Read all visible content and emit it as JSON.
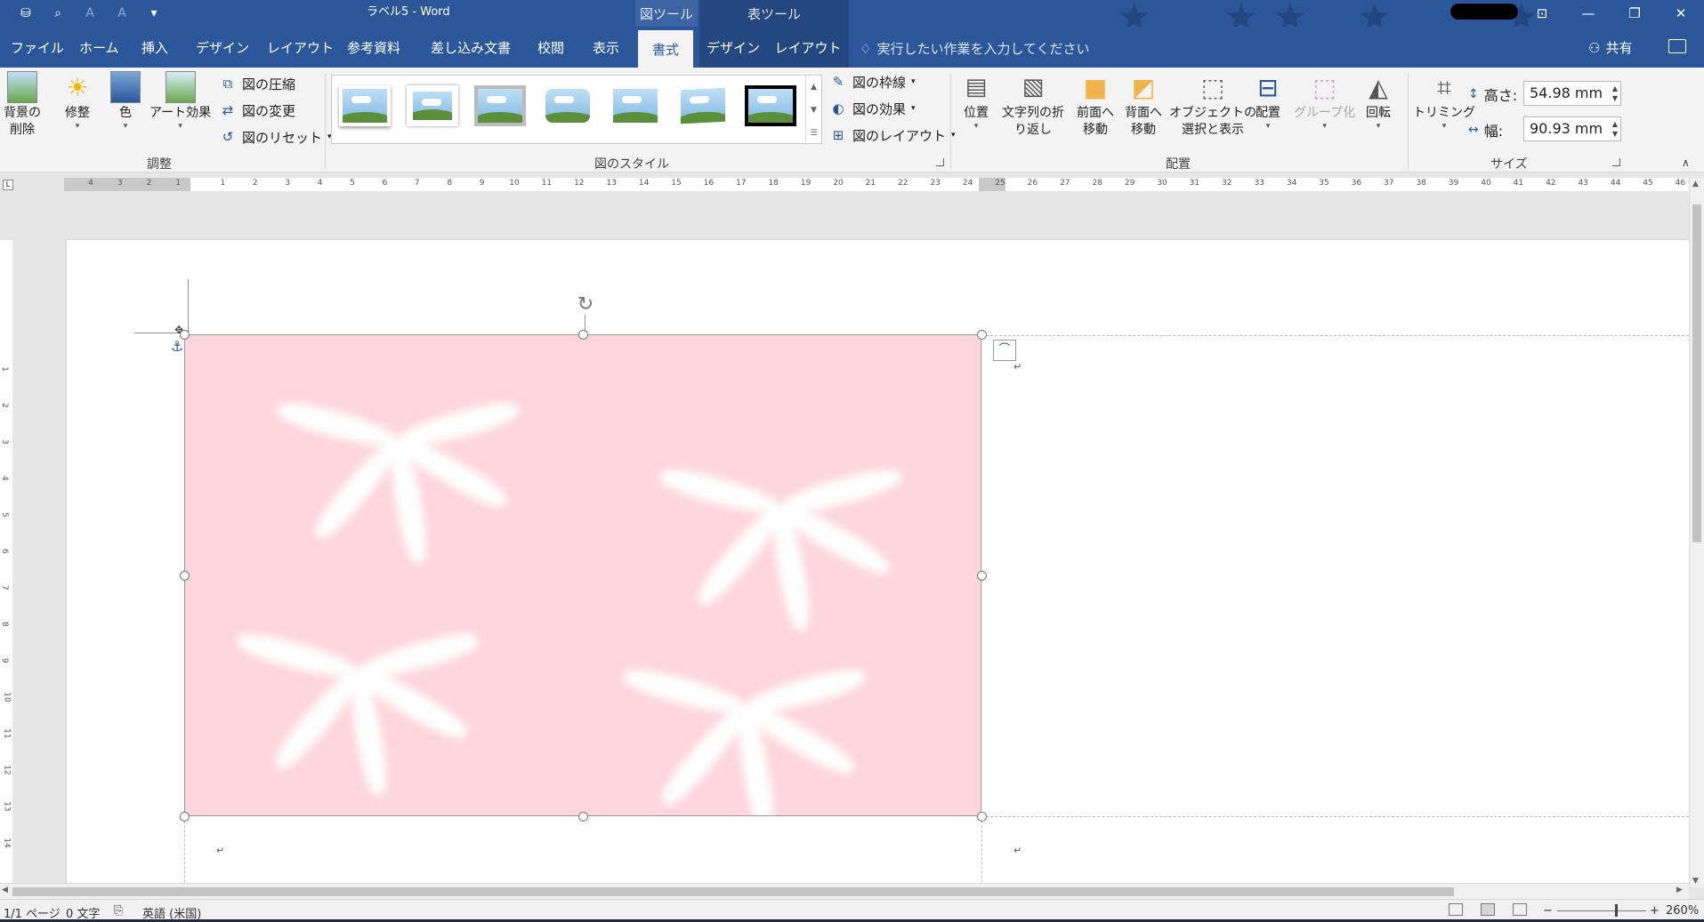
{
  "titlebar": {
    "doc_title": "ラベル5 - Word",
    "context_tab_picture_tools": "図ツール",
    "context_tab_table_tools": "表ツール",
    "window_buttons": [
      "ribbon-display",
      "minimize",
      "restore",
      "close"
    ]
  },
  "tabs": [
    {
      "label": "ファイル"
    },
    {
      "label": "ホーム"
    },
    {
      "label": "挿入"
    },
    {
      "label": "デザイン"
    },
    {
      "label": "レイアウト"
    },
    {
      "label": "参考資料"
    },
    {
      "label": "差し込み文書"
    },
    {
      "label": "校閲"
    },
    {
      "label": "表示"
    },
    {
      "label": "書式"
    },
    {
      "label": "デザイン"
    },
    {
      "label": "レイアウト"
    }
  ],
  "tell_me": "実行したい作業を入力してください",
  "share": "共有",
  "ribbon": {
    "adjust": {
      "remove_bg_1": "背景の",
      "remove_bg_2": "削除",
      "corrections": "修整",
      "color": "色",
      "artistic": "アート効果",
      "compress": "図の圧縮",
      "change": "図の変更",
      "reset": "図のリセット",
      "group_label": "調整"
    },
    "styles": {
      "border": "図の枠線",
      "effects": "図の効果",
      "layout": "図のレイアウト",
      "group_label": "図のスタイル"
    },
    "arrange": {
      "position": "位置",
      "wrap_1": "文字列の折",
      "wrap_2": "り返し",
      "forward_1": "前面へ",
      "forward_2": "移動",
      "backward_1": "背面へ",
      "backward_2": "移動",
      "selection_1": "オブジェクトの",
      "selection_2": "選択と表示",
      "align": "配置",
      "group": "グループ化",
      "rotate": "回転",
      "group_label": "配置"
    },
    "size": {
      "crop": "トリミング",
      "height_label": "高さ:",
      "height_value": "54.98 mm",
      "width_label": "幅:",
      "width_value": "90.93 mm",
      "group_label": "サイズ"
    }
  },
  "ruler": {
    "left_numbers": [
      "4",
      "3",
      "2",
      "1"
    ],
    "numbers": [
      "1",
      "2",
      "3",
      "4",
      "5",
      "6",
      "7",
      "8",
      "9",
      "10",
      "11",
      "12",
      "13",
      "14",
      "15",
      "16",
      "17",
      "18",
      "19",
      "20",
      "21",
      "22",
      "23",
      "24",
      "25",
      "26",
      "27",
      "28",
      "29",
      "30",
      "31",
      "32",
      "33",
      "34",
      "35",
      "36",
      "37",
      "38",
      "39",
      "40",
      "41",
      "42",
      "43",
      "44",
      "45",
      "46"
    ],
    "vertical_numbers": [
      "1",
      "2",
      "3",
      "4",
      "5",
      "6",
      "7",
      "8",
      "9",
      "10",
      "11",
      "12",
      "13",
      "14"
    ]
  },
  "statusbar": {
    "page": "1/1 ページ",
    "words": "0 文字",
    "language": "英語 (米国)",
    "zoom": "260%"
  },
  "colors": {
    "brand_blue": "#2b579a",
    "picture_pink": "#ffd6dd"
  }
}
